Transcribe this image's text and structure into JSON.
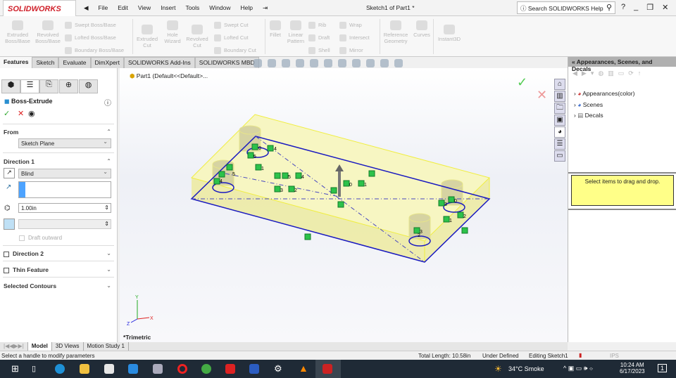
{
  "app": {
    "logo": "SOLIDWORKS",
    "menus": [
      "File",
      "Edit",
      "View",
      "Insert",
      "Tools",
      "Window",
      "Help"
    ],
    "doc_title": "Sketch1 of Part1 *",
    "search_placeholder": "Search SOLIDWORKS Help"
  },
  "ribbon": {
    "big": [
      "Extruded Boss/Base",
      "Revolved Boss/Base",
      "Extruded Cut",
      "Hole Wizard",
      "Revolved Cut",
      "Fillet",
      "Linear Pattern",
      "Reference Geometry",
      "Curves",
      "Instant3D"
    ],
    "small": [
      "Swept Boss/Base",
      "Lofted Boss/Base",
      "Boundary Boss/Base",
      "Swept Cut",
      "Lofted Cut",
      "Boundary Cut",
      "Rib",
      "Draft",
      "Shell",
      "Wrap",
      "Intersect",
      "Mirror"
    ]
  },
  "tabs": [
    "Features",
    "Sketch",
    "Evaluate",
    "DimXpert",
    "SOLIDWORKS Add-Ins",
    "SOLIDWORKS MBD"
  ],
  "tree": {
    "root": "Part1  (Default<<Default>..."
  },
  "pm": {
    "title": "Boss-Extrude",
    "from_label": "From",
    "from_value": "Sketch Plane",
    "dir1_label": "Direction 1",
    "end_condition": "Blind",
    "depth": "1.00in",
    "draft": "Draft outward",
    "dir2": "Direction 2",
    "thin": "Thin Feature",
    "contours": "Selected Contours"
  },
  "viewport": {
    "view_label": "*Trimetric",
    "axes": {
      "x": "X",
      "y": "Y",
      "z": "Z"
    },
    "relation_labels": [
      "0",
      "4",
      "5",
      "1",
      "5",
      "4",
      "5",
      "4",
      "3",
      "2",
      "0",
      "1",
      "3",
      "0",
      "2",
      "1",
      "3",
      "2"
    ]
  },
  "task_pane": {
    "title": "« Appearances, Scenes, and Decals",
    "items": [
      "Appearances(color)",
      "Scenes",
      "Decals"
    ],
    "hint": "Select items to drag and drop."
  },
  "bottom_tabs": [
    "Model",
    "3D Views",
    "Motion Study 1"
  ],
  "status": {
    "message": "Select a handle to modify parameters",
    "total_length": "Total Length: 10.58in",
    "state": "Under Defined",
    "editing": "Editing Sketch1",
    "units": "IPS"
  },
  "taskbar": {
    "weather": "34°C  Smoke",
    "time": "10:24 AM",
    "date": "6/17/2023",
    "notif": "1"
  }
}
